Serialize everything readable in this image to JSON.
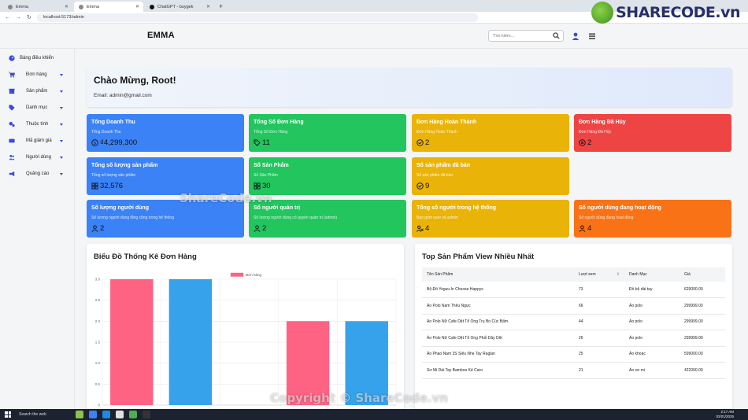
{
  "browser": {
    "tabs": [
      {
        "title": "Emma",
        "active": false
      },
      {
        "title": "Emma",
        "active": true
      },
      {
        "title": "ChatGPT - buygek",
        "active": false
      }
    ],
    "url": "localhost:5173/admin"
  },
  "watermark": {
    "logo_text": "SHARECODE.vn",
    "center_text": "ShareCode.vn",
    "bottom_text": "Copyright © ShareCode.vn"
  },
  "header": {
    "brand": "EMMA",
    "search_placeholder": "Tìm kiếm..."
  },
  "sidebar": {
    "items": [
      {
        "label": "Bảng điều khiển",
        "icon": "dashboard-icon",
        "has_caret": false
      },
      {
        "label": "Đơn hàng",
        "icon": "cart-icon",
        "has_caret": true
      },
      {
        "label": "Sản phẩm",
        "icon": "box-icon",
        "has_caret": true
      },
      {
        "label": "Danh mục",
        "icon": "tags-icon",
        "has_caret": true
      },
      {
        "label": "Thuộc tính",
        "icon": "cogs-icon",
        "has_caret": true
      },
      {
        "label": "Mã giảm giá",
        "icon": "ticket-icon",
        "has_caret": true
      },
      {
        "label": "Người dùng",
        "icon": "users-icon",
        "has_caret": true
      },
      {
        "label": "Quảng cáo",
        "icon": "megaphone-icon",
        "has_caret": true
      }
    ]
  },
  "welcome": {
    "title": "Chào Mừng, Root!",
    "email": "Email: admin@gmail.com"
  },
  "cards": [
    {
      "title": "Tổng Doanh Thu",
      "subtitle": "Tổng Doanh Thu",
      "value": "₫4,299,300",
      "color": "#3b82f6",
      "icon": "money-icon"
    },
    {
      "title": "Tổng Số Đơn Hàng",
      "subtitle": "Tổng Số Đơn Hàng",
      "value": "11",
      "color": "#22c55e",
      "icon": "tag-icon"
    },
    {
      "title": "Đơn Hàng Hoàn Thành",
      "subtitle": "Đơn Hàng Hoàn Thành",
      "value": "2",
      "color": "#eab308",
      "icon": "check-circle-icon"
    },
    {
      "title": "Đơn Hàng Đã Hủy",
      "subtitle": "Đơn Hàng Đã Hủy",
      "value": "2",
      "color": "#ef4444",
      "icon": "x-circle-icon"
    },
    {
      "title": "Tổng số lượng sản phẩm",
      "subtitle": "Tổng số lượng sản phẩm",
      "value": "32,576",
      "color": "#3b82f6",
      "icon": "grid-icon"
    },
    {
      "title": "Số Sản Phẩm",
      "subtitle": "Số Sản Phẩm",
      "value": "30",
      "color": "#22c55e",
      "icon": "grid-icon"
    },
    {
      "title": "Số sản phẩm đã bán",
      "subtitle": "Số sản phẩm đã bán",
      "value": "9",
      "color": "#eab308",
      "icon": "check-circle-icon"
    },
    {
      "title": "Số lượng người dùng",
      "subtitle": "Số lượng người dùng tổng cộng trong hệ thống",
      "value": "2",
      "color": "#3b82f6",
      "icon": "user-icon"
    },
    {
      "title": "Số người quản trị",
      "subtitle": "Số lượng người dùng có quyền quản trị (admin)",
      "value": "2",
      "color": "#22c55e",
      "icon": "user-icon"
    },
    {
      "title": "Tổng số người trong hệ thống",
      "subtitle": "Bao gồm user và admin",
      "value": "4",
      "color": "#eab308",
      "icon": "users-icon"
    },
    {
      "title": "Số người dùng đang hoạt động",
      "subtitle": "Số người dùng đang hoạt động",
      "value": "4",
      "color": "#f97316",
      "icon": "user-icon"
    }
  ],
  "chart_panel": {
    "title": "Biểu Đồ Thống Kê Đơn Hàng"
  },
  "chart_data": {
    "type": "bar",
    "legend": "Đơn hàng",
    "legend_position": "top-center",
    "grid": true,
    "ylim": [
      0,
      3.0
    ],
    "yticks": [
      "3.0",
      "2.5",
      "2.0",
      "1.5",
      "1.0",
      "0.5",
      "0"
    ],
    "values": [
      3,
      3,
      0,
      2,
      2
    ],
    "bar_colors": [
      "#ff6384",
      "#36a2eb",
      "#ffce56",
      "#ff6384",
      "#36a2eb"
    ]
  },
  "top_products": {
    "title": "Top Sản Phẩm View Nhiều Nhất",
    "columns": [
      "Tên Sản Phẩm",
      "Lượt xem",
      "Danh Mục",
      "Giá"
    ],
    "rows": [
      [
        "Bộ Đồ Yoguu In Choose Happys",
        "73",
        "Đồ bộ dài tay",
        "629000.00"
      ],
      [
        "Áo Polo Nam Thêu Ngực",
        "66",
        "Áo polo",
        "299999.00"
      ],
      [
        "Áo Polo Nữ Cafe Dệt Tổ Ong Trụ Bo Cúc Bấm",
        "44",
        "Áo polo",
        "299999.00"
      ],
      [
        "Áo Polo Nữ Cafe Dệt Tổ Ong Phối Dây Dệt",
        "26",
        "Áo polo",
        "299999.00"
      ],
      [
        "Áo Phao Nam 3S Siêu Nhẹ Tay Raglan",
        "25",
        "Áo khoác",
        "599000.00"
      ],
      [
        "Sơ Mi Dài Tay Bamboo Kẻ Caro",
        "21",
        "Áo sơ mi",
        "422000.00"
      ]
    ]
  },
  "taskbar": {
    "search": "Search the web",
    "time": "2:17 AM",
    "date": "02/01/2025"
  }
}
